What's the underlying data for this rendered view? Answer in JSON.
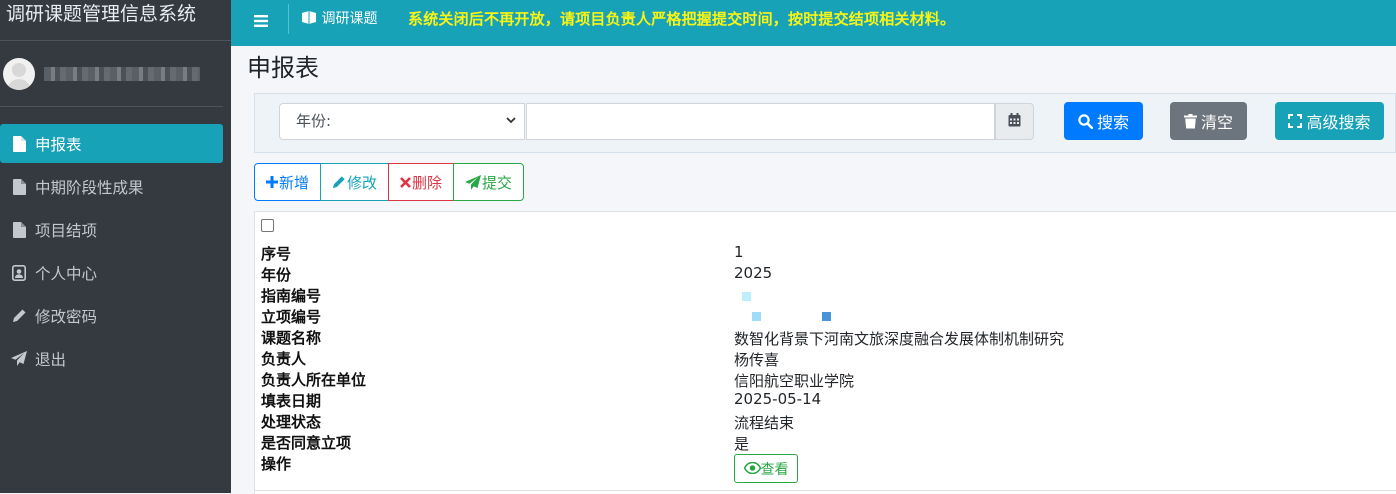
{
  "app": {
    "title": "调研课题管理信息系统"
  },
  "sidebar": {
    "items": [
      {
        "label": "申报表",
        "icon": "file-icon",
        "active": true
      },
      {
        "label": "中期阶段性成果",
        "icon": "file-icon",
        "active": false
      },
      {
        "label": "项目结项",
        "icon": "file-icon",
        "active": false
      },
      {
        "label": "个人中心",
        "icon": "user-card-icon",
        "active": false
      },
      {
        "label": "修改密码",
        "icon": "pencil-icon",
        "active": false
      },
      {
        "label": "退出",
        "icon": "paper-plane-icon",
        "active": false
      }
    ]
  },
  "topbar": {
    "module": "调研课题",
    "notice": "系统关闭后不再开放，请项目负责人严格把握提交时间，按时提交结项相关材料。"
  },
  "page": {
    "title": "申报表"
  },
  "search": {
    "year_select": "年份:",
    "search_label": "搜索",
    "clear_label": "清空",
    "advanced_label": "高级搜索"
  },
  "toolbar": {
    "add": "新增",
    "edit": "修改",
    "delete": "删除",
    "submit": "提交"
  },
  "record": {
    "fields": [
      "序号",
      "年份",
      "指南编号",
      "立项编号",
      "课题名称",
      "负责人",
      "负责人所在单位",
      "填表日期",
      "处理状态",
      "是否同意立项",
      "操作"
    ],
    "values": {
      "no": "1",
      "year": "2025",
      "title": "数智化背景下河南文旅深度融合发展体制机制研究",
      "leader": "杨传喜",
      "unit": "信阳航空职业学院",
      "date": "2025-05-14",
      "status": "流程结束",
      "approved": "是",
      "view": "查看"
    }
  },
  "colors": {
    "accent": "#17a2b8",
    "sidebar": "#343a40",
    "notice": "#f8f414"
  }
}
